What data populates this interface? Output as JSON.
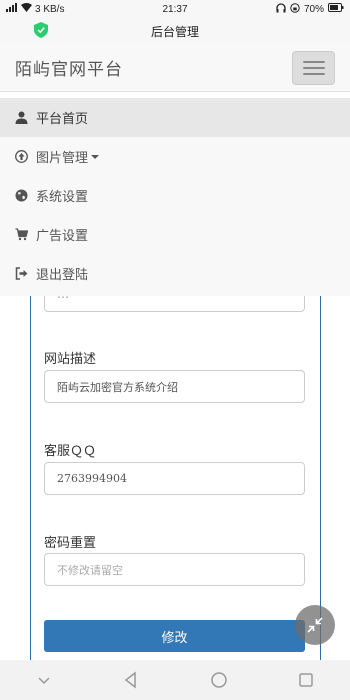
{
  "status": {
    "speed": "3 KB/s",
    "time": "21:37",
    "battery": "70%"
  },
  "app": {
    "title": "后台管理"
  },
  "navbar": {
    "brand": "陌屿官网平台"
  },
  "menu": {
    "items": [
      {
        "label": "平台首页",
        "icon": "user-icon"
      },
      {
        "label": "图片管理",
        "icon": "upload-circle-icon"
      },
      {
        "label": "系统设置",
        "icon": "globe-icon"
      },
      {
        "label": "广告设置",
        "icon": "cart-icon"
      },
      {
        "label": "退出登陆",
        "icon": "logout-icon"
      }
    ]
  },
  "form": {
    "desc_label": "网站描述",
    "desc_value": "陌屿云加密官方系统介绍",
    "qq_label": "客服ＱＱ",
    "qq_value": "2763994904",
    "pwd_label": "密码重置",
    "pwd_placeholder": "不修改请留空",
    "submit_label": "修改"
  },
  "colors": {
    "primary": "#3278b7",
    "active_menu": "#e7e7e7",
    "shield": "#2ecc71"
  }
}
